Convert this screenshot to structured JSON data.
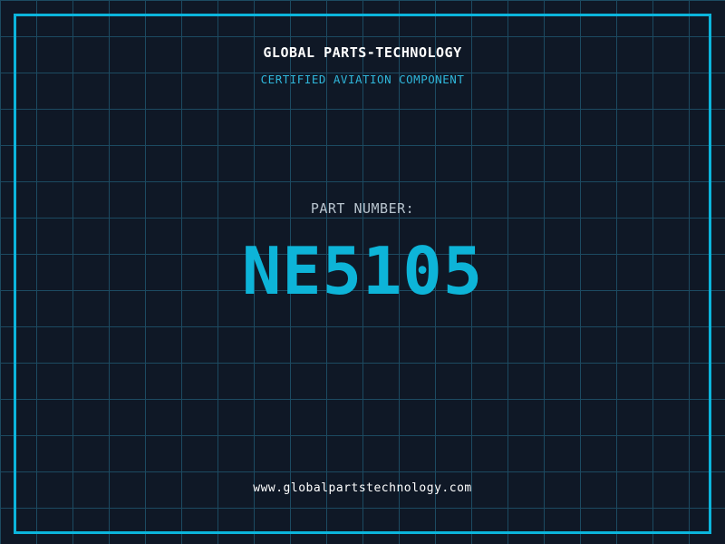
{
  "theme": {
    "background": "#0f1826",
    "grid_line": "#1c4a61",
    "frame_border": "#0bb5dc",
    "accent_cyan": "#0db4d8",
    "tagline_cyan": "#2fb6da",
    "muted_gray": "#b8c4ce",
    "white": "#ffffff"
  },
  "header": {
    "company": "GLOBAL PARTS-TECHNOLOGY",
    "tagline": "CERTIFIED AVIATION COMPONENT"
  },
  "part": {
    "label": "PART NUMBER:",
    "value": "NE5105"
  },
  "footer": {
    "url": "www.globalpartstechnology.com"
  }
}
